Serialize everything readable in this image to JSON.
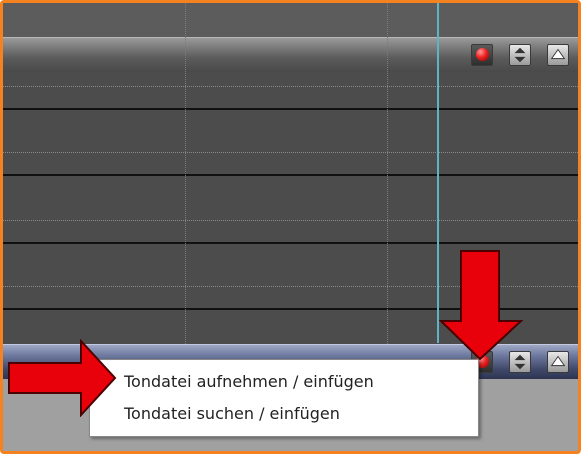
{
  "context_menu": {
    "items": [
      {
        "label": "Tondatei aufnehmen / einfügen"
      },
      {
        "label": "Tondatei suchen / einfügen"
      }
    ]
  },
  "track_header_buttons": [
    {
      "icon": "record-icon"
    },
    {
      "icon": "up-down-arrows-icon"
    },
    {
      "icon": "collapse-up-icon"
    }
  ],
  "colors": {
    "frame_border": "#f58220",
    "arrow_red": "#e8000b",
    "cursor_line": "#5fb3c6",
    "selected_header": "#414a6b"
  }
}
